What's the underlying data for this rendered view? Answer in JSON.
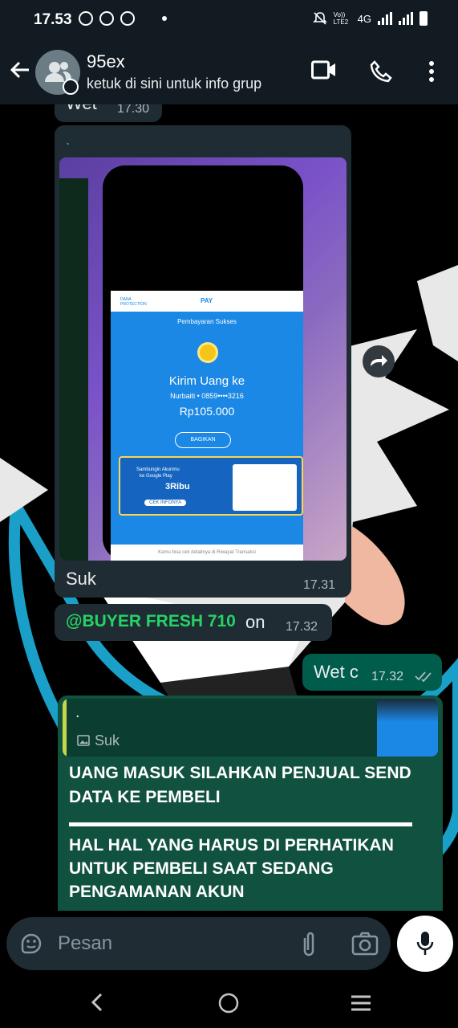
{
  "status_bar": {
    "time": "17.53",
    "network_type": "4G",
    "volte_label": "Vo)) LTE2"
  },
  "header": {
    "title": "95ex",
    "subtitle": "ketuk di sini untuk info grup"
  },
  "messages": [
    {
      "id": "m0",
      "text": "Wet",
      "time": "17.30",
      "direction": "in"
    },
    {
      "id": "m1",
      "sender_dot": ".",
      "caption": "Suk",
      "time": "17.31",
      "direction": "in",
      "has_image": true
    },
    {
      "id": "m2",
      "mention": "@BUYER FRESH 710",
      "text": "on",
      "time": "17.32",
      "direction": "in"
    },
    {
      "id": "m3",
      "text": "Wet c",
      "time": "17.32",
      "direction": "out",
      "status": "read"
    },
    {
      "id": "m4",
      "direction": "in",
      "quote": {
        "author": ".",
        "text": "Suk"
      },
      "body_line_1": "UANG MASUK SILAHKAN PENJUAL SEND DATA KE PEMBELI",
      "body_line_2": "HAL HAL YANG HARUS DI PERHATIKAN UNTUK PEMBELI SAAT SEDANG PENGAMANAN AKUN"
    }
  ],
  "receipt_image": {
    "brand": "DANA PROTECTION",
    "pay_label": "PAY",
    "status": "Pembayaran Sukses",
    "title": "Kirim Uang ke",
    "recipient": "Nurbaiti • 0859••••3216",
    "amount": "Rp105.000",
    "share_button": "BAGIKAN",
    "banner_line1": "Sambungin Akunmu",
    "banner_line2": "ke Google Play",
    "banner_bonus": "3Ribu",
    "banner_cta": "CEK INFONYA",
    "footer_note": "Kamu bisa cek detailnya di Riwayat Transaksi"
  },
  "composer": {
    "placeholder": "Pesan"
  },
  "colors": {
    "header_bg": "#111b21",
    "incoming_bubble": "#202c33",
    "outgoing_bubble": "#005c4b",
    "mention_green": "#25d366",
    "dana_blue": "#1b88e5"
  }
}
